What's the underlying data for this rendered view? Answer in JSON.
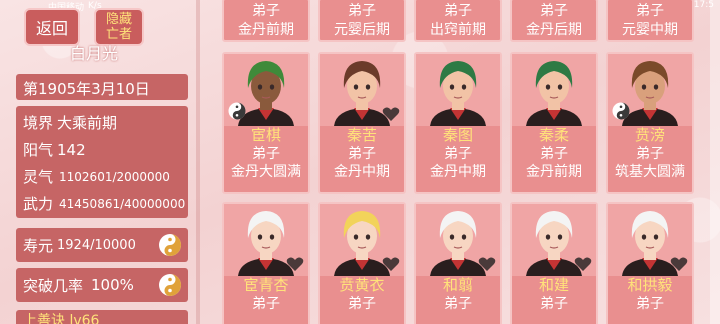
{
  "status_bar": {
    "carrier": "中国移动",
    "extra": "K/s",
    "right": "17:5"
  },
  "buttons": {
    "back": "返回",
    "hide": "隐藏亡者"
  },
  "player": {
    "name": "白月光"
  },
  "date": "第1905年3月10日",
  "stats": [
    {
      "label": "境界",
      "value": "大乘前期"
    },
    {
      "label": "阳气",
      "value": "142"
    },
    {
      "label": "灵气",
      "value": "1102601/2000000"
    },
    {
      "label": "武力",
      "value": "41450861/40000000"
    }
  ],
  "lifespan": {
    "label": "寿元",
    "value": "1924/10000"
  },
  "breakthrough": {
    "label": "突破几率",
    "value": "100%"
  },
  "partial_row": "上善诀 lv66",
  "top_cards": [
    {
      "role": "弟子",
      "realm": "金丹前期"
    },
    {
      "role": "弟子",
      "realm": "元婴后期"
    },
    {
      "role": "弟子",
      "realm": "出窍前期"
    },
    {
      "role": "弟子",
      "realm": "金丹后期"
    },
    {
      "role": "弟子",
      "realm": "元婴中期"
    }
  ],
  "mid_cards": [
    {
      "name": "宦棋",
      "role": "弟子",
      "realm": "金丹大圆满",
      "hair": "#3f8a3a",
      "skin": "#8a5a3c",
      "yinyang": true,
      "heart": false
    },
    {
      "name": "秦苦",
      "role": "弟子",
      "realm": "金丹中期",
      "hair": "#6b3b2a",
      "skin": "#f2c3a6",
      "yinyang": false,
      "heart": true
    },
    {
      "name": "秦图",
      "role": "弟子",
      "realm": "金丹中期",
      "hair": "#2e7a44",
      "skin": "#f2c3a6",
      "yinyang": false,
      "heart": false
    },
    {
      "name": "秦柔",
      "role": "弟子",
      "realm": "金丹前期",
      "hair": "#2e7a44",
      "skin": "#f2c3a6",
      "yinyang": false,
      "heart": false
    },
    {
      "name": "贲滂",
      "role": "弟子",
      "realm": "筑基大圆满",
      "hair": "#7a4a2a",
      "skin": "#d9a07c",
      "yinyang": true,
      "heart": false
    }
  ],
  "bottom_cards": [
    {
      "name": "宦青杏",
      "role": "弟子",
      "hair": "#f4f4f4",
      "skin": "#f7d6c2",
      "heart": true
    },
    {
      "name": "贲黄衣",
      "role": "弟子",
      "hair": "#f2d35a",
      "skin": "#f7d6c2",
      "heart": true
    },
    {
      "name": "和翦",
      "role": "弟子",
      "hair": "#f4f4f4",
      "skin": "#f7d6c2",
      "heart": true
    },
    {
      "name": "和建",
      "role": "弟子",
      "hair": "#f4f4f4",
      "skin": "#f7d6c2",
      "heart": true
    },
    {
      "name": "和拱毅",
      "role": "弟子",
      "hair": "#f4f4f4",
      "skin": "#f7d6c2",
      "heart": true
    }
  ]
}
